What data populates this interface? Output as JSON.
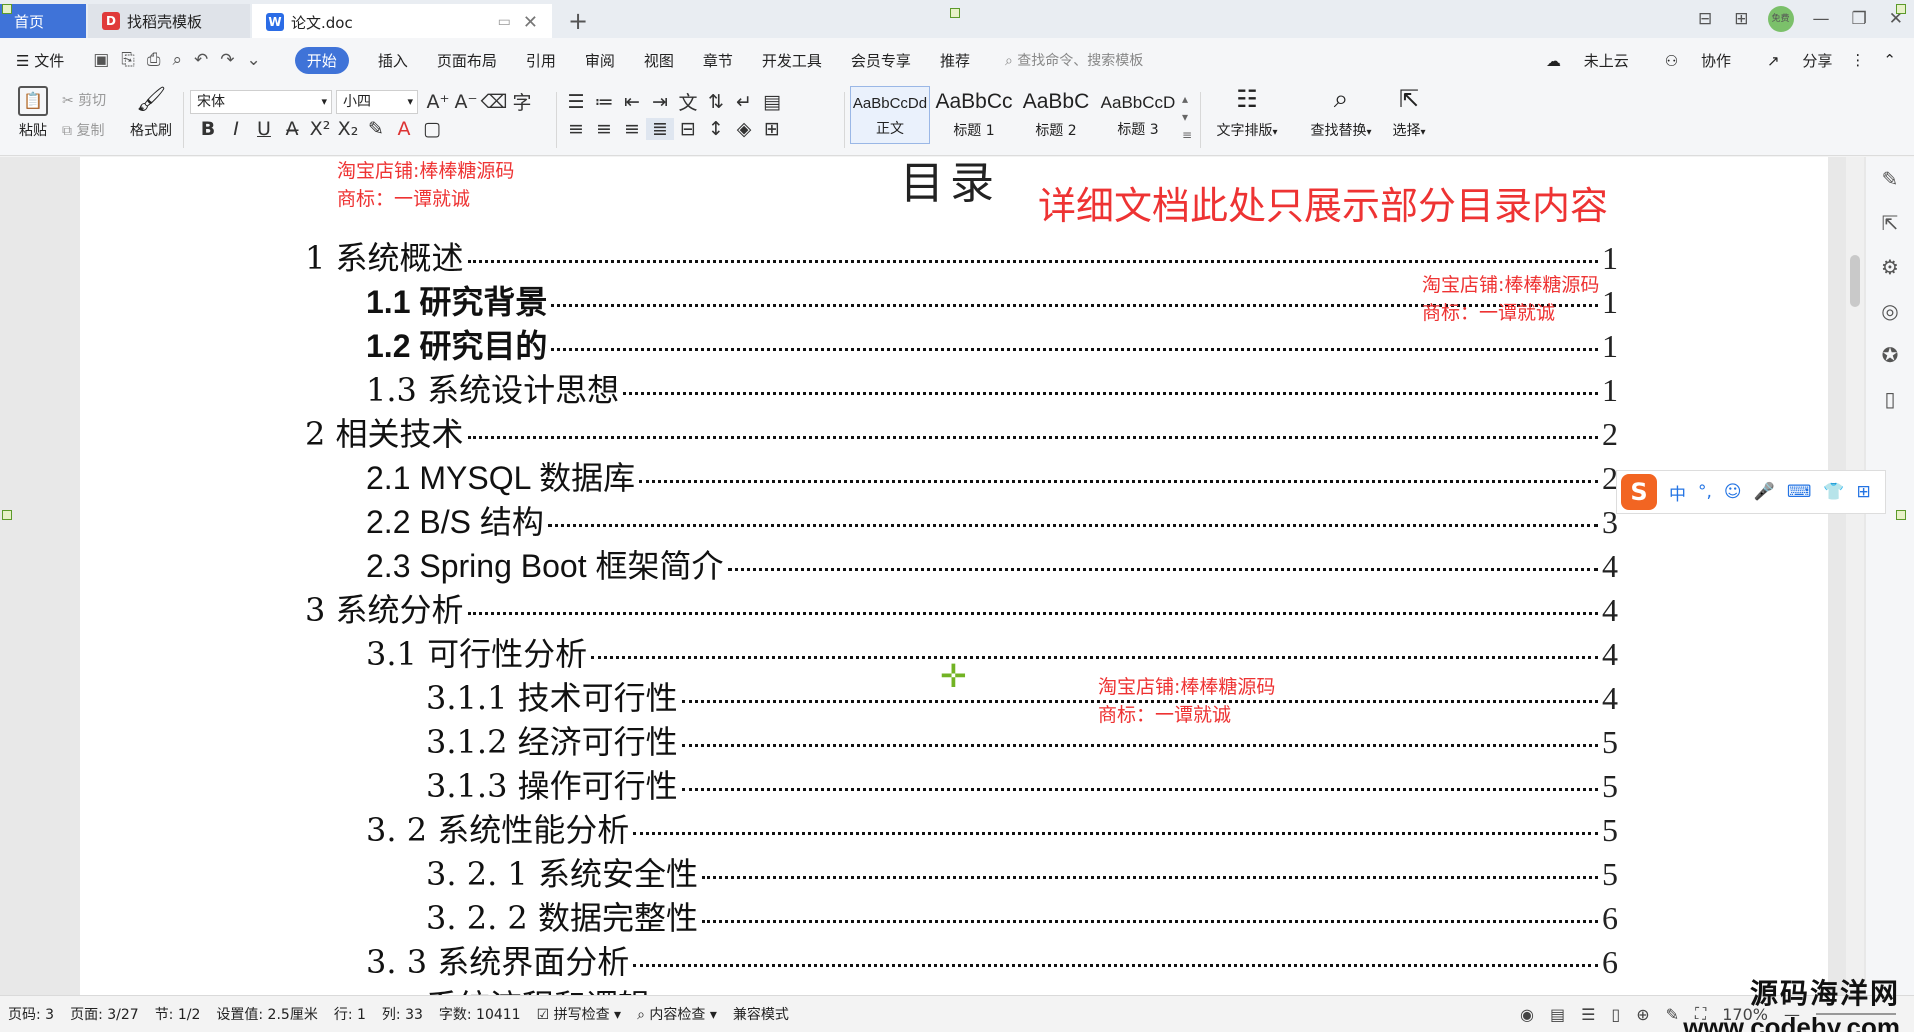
{
  "titlebar": {
    "tabs": [
      {
        "label": "首页"
      },
      {
        "label": "找稻壳模板"
      },
      {
        "label": "论文.doc"
      }
    ],
    "avatar_text": "免费"
  },
  "menubar": {
    "file": "文件",
    "tabs": [
      "开始",
      "插入",
      "页面布局",
      "引用",
      "审阅",
      "视图",
      "章节",
      "开发工具",
      "会员专享",
      "推荐"
    ],
    "search_placeholder": "查找命令、搜索模板",
    "cloud": "未上云",
    "collab": "协作",
    "share": "分享"
  },
  "ribbon": {
    "paste": "粘贴",
    "cut": "剪切",
    "copy": "复制",
    "format_painter": "格式刷",
    "font_name": "宋体",
    "font_size": "小四",
    "styles": [
      {
        "sample": "AaBbCcDd",
        "name": "正文"
      },
      {
        "sample": "AaBbCc",
        "name": "标题 1"
      },
      {
        "sample": "AaBbC",
        "name": "标题 2"
      },
      {
        "sample": "AaBbCcD",
        "name": "标题 3"
      }
    ],
    "text_layout": "文字排版",
    "find_replace": "查找替换",
    "select": "选择"
  },
  "document": {
    "toc_title": "目录",
    "shop_line1": "淘宝店铺:棒棒糖源码",
    "shop_line2": "商标：一谭就诚",
    "notice": "详细文档此处只展示部分目录内容",
    "toc": [
      {
        "label": "1 系统概述",
        "page": "1"
      },
      {
        "label": "1.1  研究背景",
        "page": "1"
      },
      {
        "label": "1.2 研究目的",
        "page": "1"
      },
      {
        "label": "1.3 系统设计思想",
        "page": "1"
      },
      {
        "label": "2 相关技术",
        "page": "2"
      },
      {
        "label": "2.1 MYSQL 数据库",
        "page": "2"
      },
      {
        "label": "2.2 B/S 结构",
        "page": "3"
      },
      {
        "label": "2.3 Spring Boot 框架简介",
        "page": "4"
      },
      {
        "label": "3 系统分析",
        "page": "4"
      },
      {
        "label": "3.1 可行性分析",
        "page": "4"
      },
      {
        "label": "3.1.1 技术可行性",
        "page": "4"
      },
      {
        "label": "3.1.2 经济可行性",
        "page": "5"
      },
      {
        "label": "3.1.3 操作可行性",
        "page": "5"
      },
      {
        "label": "3. 2 系统性能分析",
        "page": "5"
      },
      {
        "label": "3. 2. 1  系统安全性",
        "page": "5"
      },
      {
        "label": "3. 2. 2  数据完整性",
        "page": "6"
      },
      {
        "label": "3. 3 系统界面分析",
        "page": "6"
      }
    ],
    "partial_next": "系统流程和逻辑"
  },
  "ime": {
    "mode": "中"
  },
  "statusbar": {
    "page_code": "页码: 3",
    "page": "页面: 3/27",
    "section": "节: 1/2",
    "setting": "设置值: 2.5厘米",
    "row": "行: 1",
    "col": "列: 33",
    "word_count": "字数: 10411",
    "spell_check": "拼写检查",
    "content_check": "内容检查",
    "compat": "兼容模式",
    "zoom": "170%"
  },
  "watermark": {
    "line1": "源码海洋网",
    "line2": "www.codehy.com"
  }
}
